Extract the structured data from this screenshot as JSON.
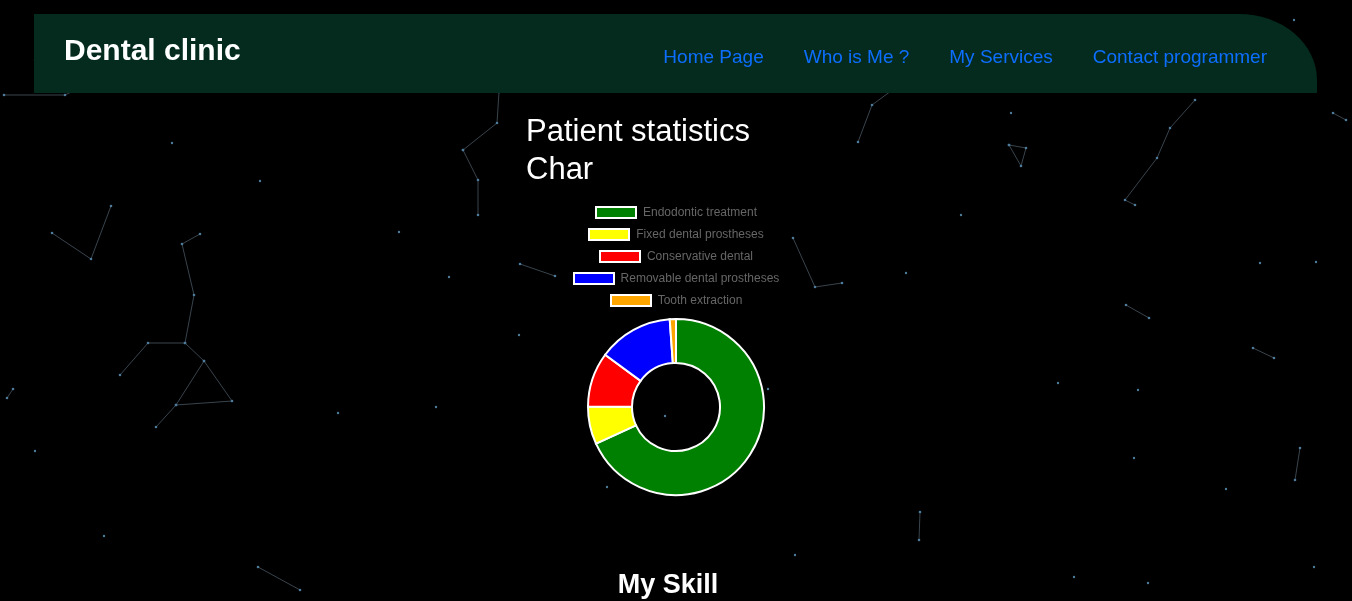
{
  "header": {
    "title": "Dental clinic",
    "nav": [
      "Home Page",
      "Who is Me ?",
      "My Services",
      "Contact programmer"
    ]
  },
  "chart_section": {
    "title": "Patient statistics Char",
    "legend": [
      {
        "label": "Endodontic treatment",
        "color": "#008000"
      },
      {
        "label": "Fixed dental prostheses",
        "color": "#ffff00"
      },
      {
        "label": "Conservative dental",
        "color": "#ff0000"
      },
      {
        "label": "Removable dental prostheses",
        "color": "#0000ff"
      },
      {
        "label": "Tooth extraction",
        "color": "#ffa500"
      }
    ]
  },
  "skills_section": {
    "title": "My Skill"
  }
}
